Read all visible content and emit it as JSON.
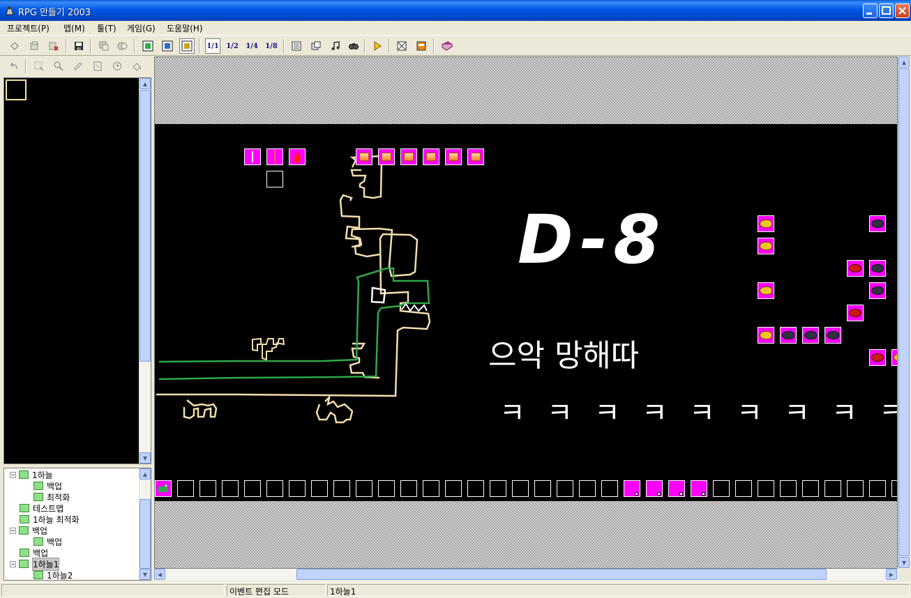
{
  "window": {
    "title": "RPG 만들기 2003",
    "controls": [
      "minimize",
      "maximize",
      "close"
    ]
  },
  "menu": [
    {
      "label": "프로젝트(P)"
    },
    {
      "label": "맵(M)"
    },
    {
      "label": "툴(T)"
    },
    {
      "label": "게임(G)"
    },
    {
      "label": "도움말(H)"
    }
  ],
  "toolbar": {
    "buttons": [
      "new-project-icon",
      "open-project-icon",
      "close-project-icon",
      "save-icon",
      "lower-layer-icon",
      "upper-layer-icon",
      "map-layer1-icon",
      "map-layer2-icon",
      "event-layer-icon",
      "zoom-1-1",
      "zoom-1-2",
      "zoom-1-4",
      "zoom-1-8",
      "database-icon",
      "material-icon",
      "music-icon",
      "search-icon",
      "play-test-icon",
      "fullscreen-icon",
      "title-icon",
      "help-book-icon"
    ],
    "zoom_labels": [
      "1/1",
      "1/2",
      "1/4",
      "1/8"
    ]
  },
  "left_tools": [
    "undo-icon",
    "select-icon",
    "zoom-icon",
    "pencil-icon",
    "rectangle-icon",
    "circle-icon",
    "fill-icon"
  ],
  "map_tree": [
    {
      "label": "1하늘",
      "indent": 1,
      "toggle": "−"
    },
    {
      "label": "백업",
      "indent": 2
    },
    {
      "label": "최적화",
      "indent": 2
    },
    {
      "label": "테스트맵",
      "indent": 1
    },
    {
      "label": "1하늘 최적화",
      "indent": 1
    },
    {
      "label": "백업",
      "indent": 1,
      "toggle": "−"
    },
    {
      "label": "백업",
      "indent": 2
    },
    {
      "label": "백업",
      "indent": 1
    },
    {
      "label": "1하늘1",
      "indent": 1,
      "toggle": "−",
      "selected": true
    },
    {
      "label": "1하늘2",
      "indent": 2
    }
  ],
  "map": {
    "title_text": "D-8",
    "scream_text": "으악 망해따",
    "laugh_glyph": "ㅋ",
    "laugh_count": 9,
    "colors": {
      "event_bg": "#ff00ff",
      "map_bg": "#000000",
      "green_line": "#2fa84a",
      "cream_line": "#f3dfae"
    }
  },
  "status": {
    "mode": "이벤트 편집 모드",
    "map_name": "1하늘1"
  }
}
